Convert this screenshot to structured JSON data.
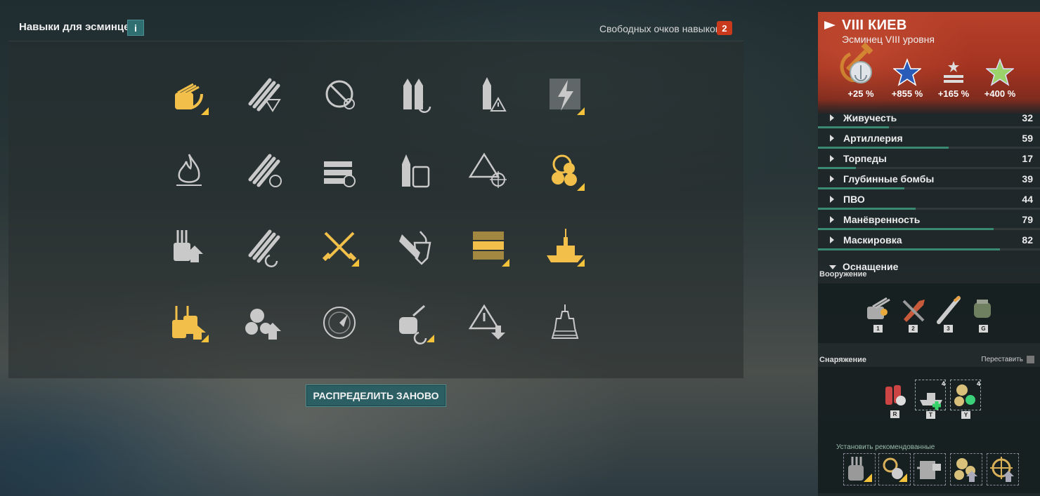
{
  "header": {
    "title": "Навыки для эсминцев",
    "info_label": "i",
    "free_points_label": "Свободных очков навыков:",
    "free_points": "2"
  },
  "actions": {
    "redistribute_label": "РАСПРЕДЕЛИТЬ ЗАНОВО"
  },
  "skills": {
    "rows": [
      [
        {
          "icon": "gun-rotation-icon",
          "active": true,
          "corner": true
        },
        {
          "icon": "torpedo-down-icon",
          "active": false,
          "corner": false
        },
        {
          "icon": "prohibited-icon",
          "active": false,
          "corner": false
        },
        {
          "icon": "shells-reload-icon",
          "active": false,
          "corner": false
        },
        {
          "icon": "shell-warning-icon",
          "active": false,
          "corner": false
        },
        {
          "icon": "lightning-icon",
          "active": false,
          "corner": true
        }
      ],
      [
        {
          "icon": "fire-icon",
          "active": false,
          "corner": false
        },
        {
          "icon": "torpedo-speed-icon",
          "active": false,
          "corner": false
        },
        {
          "icon": "repair-timer-icon",
          "active": false,
          "corner": false
        },
        {
          "icon": "shell-barrels-icon",
          "active": false,
          "corner": false
        },
        {
          "icon": "warning-target-icon",
          "active": false,
          "corner": false
        },
        {
          "icon": "helm-propeller-icon",
          "active": true,
          "corner": true
        }
      ],
      [
        {
          "icon": "turret-up-icon",
          "active": false,
          "corner": false
        },
        {
          "icon": "torpedo-reload-icon",
          "active": false,
          "corner": false
        },
        {
          "icon": "crossed-swords-icon",
          "active": true,
          "corner": true
        },
        {
          "icon": "fire-shield-icon",
          "active": false,
          "corner": false
        },
        {
          "icon": "repair-party-icon",
          "active": true,
          "corner": true
        },
        {
          "icon": "ship-silhouette-icon",
          "active": true,
          "corner": true
        }
      ],
      [
        {
          "icon": "turret-double-up-icon",
          "active": true,
          "corner": true
        },
        {
          "icon": "propeller-up-icon",
          "active": false,
          "corner": false
        },
        {
          "icon": "radar-icon",
          "active": false,
          "corner": false
        },
        {
          "icon": "grenade-reload-icon",
          "active": false,
          "corner": true
        },
        {
          "icon": "warning-down-icon",
          "active": false,
          "corner": false
        },
        {
          "icon": "ship-front-icon",
          "active": false,
          "corner": false
        }
      ]
    ]
  },
  "ship": {
    "name": "VIII КИЕВ",
    "subtitle": "Эсминец VIII уровня",
    "bonuses": [
      {
        "icon": "silver-coins-icon",
        "value": "+25 %"
      },
      {
        "icon": "blue-star-icon",
        "value": "+855 %"
      },
      {
        "icon": "rank-star-icon",
        "value": "+165 %"
      },
      {
        "icon": "green-star-icon",
        "value": "+400 %"
      }
    ],
    "stats": [
      {
        "label": "Живучесть",
        "value": "32",
        "fill": 0.32
      },
      {
        "label": "Артиллерия",
        "value": "59",
        "fill": 0.59
      },
      {
        "label": "Торпеды",
        "value": "17",
        "fill": 0.17
      },
      {
        "label": "Глубинные бомбы",
        "value": "39",
        "fill": 0.39
      },
      {
        "label": "ПВО",
        "value": "44",
        "fill": 0.44
      },
      {
        "label": "Манёвренность",
        "value": "79",
        "fill": 0.79
      },
      {
        "label": "Маскировка",
        "value": "82",
        "fill": 0.82
      }
    ],
    "equipment_label": "Оснащение",
    "armament_label": "Вооружение",
    "armament": [
      {
        "icon": "main-battery-icon",
        "key": "1"
      },
      {
        "icon": "shell-icon",
        "key": "2"
      },
      {
        "icon": "torpedo-icon",
        "key": "3"
      },
      {
        "icon": "depth-charge-icon",
        "key": "G"
      }
    ],
    "supplies_label": "Снаряжение",
    "rearrange_label": "Переставить",
    "supplies": [
      {
        "icon": "damage-control-icon",
        "key": "R",
        "count": ""
      },
      {
        "icon": "repair-party-supply-icon",
        "key": "T",
        "count": "4"
      },
      {
        "icon": "engine-boost-icon",
        "key": "Y",
        "count": "4"
      }
    ],
    "recommended_label": "Установить рекомендованные",
    "upgrades": [
      {
        "icon": "main-armaments-mod-icon"
      },
      {
        "icon": "propulsion-mod-icon"
      },
      {
        "icon": "aiming-systems-icon"
      },
      {
        "icon": "engine-boost-mod-icon"
      },
      {
        "icon": "steering-gears-icon"
      }
    ]
  }
}
